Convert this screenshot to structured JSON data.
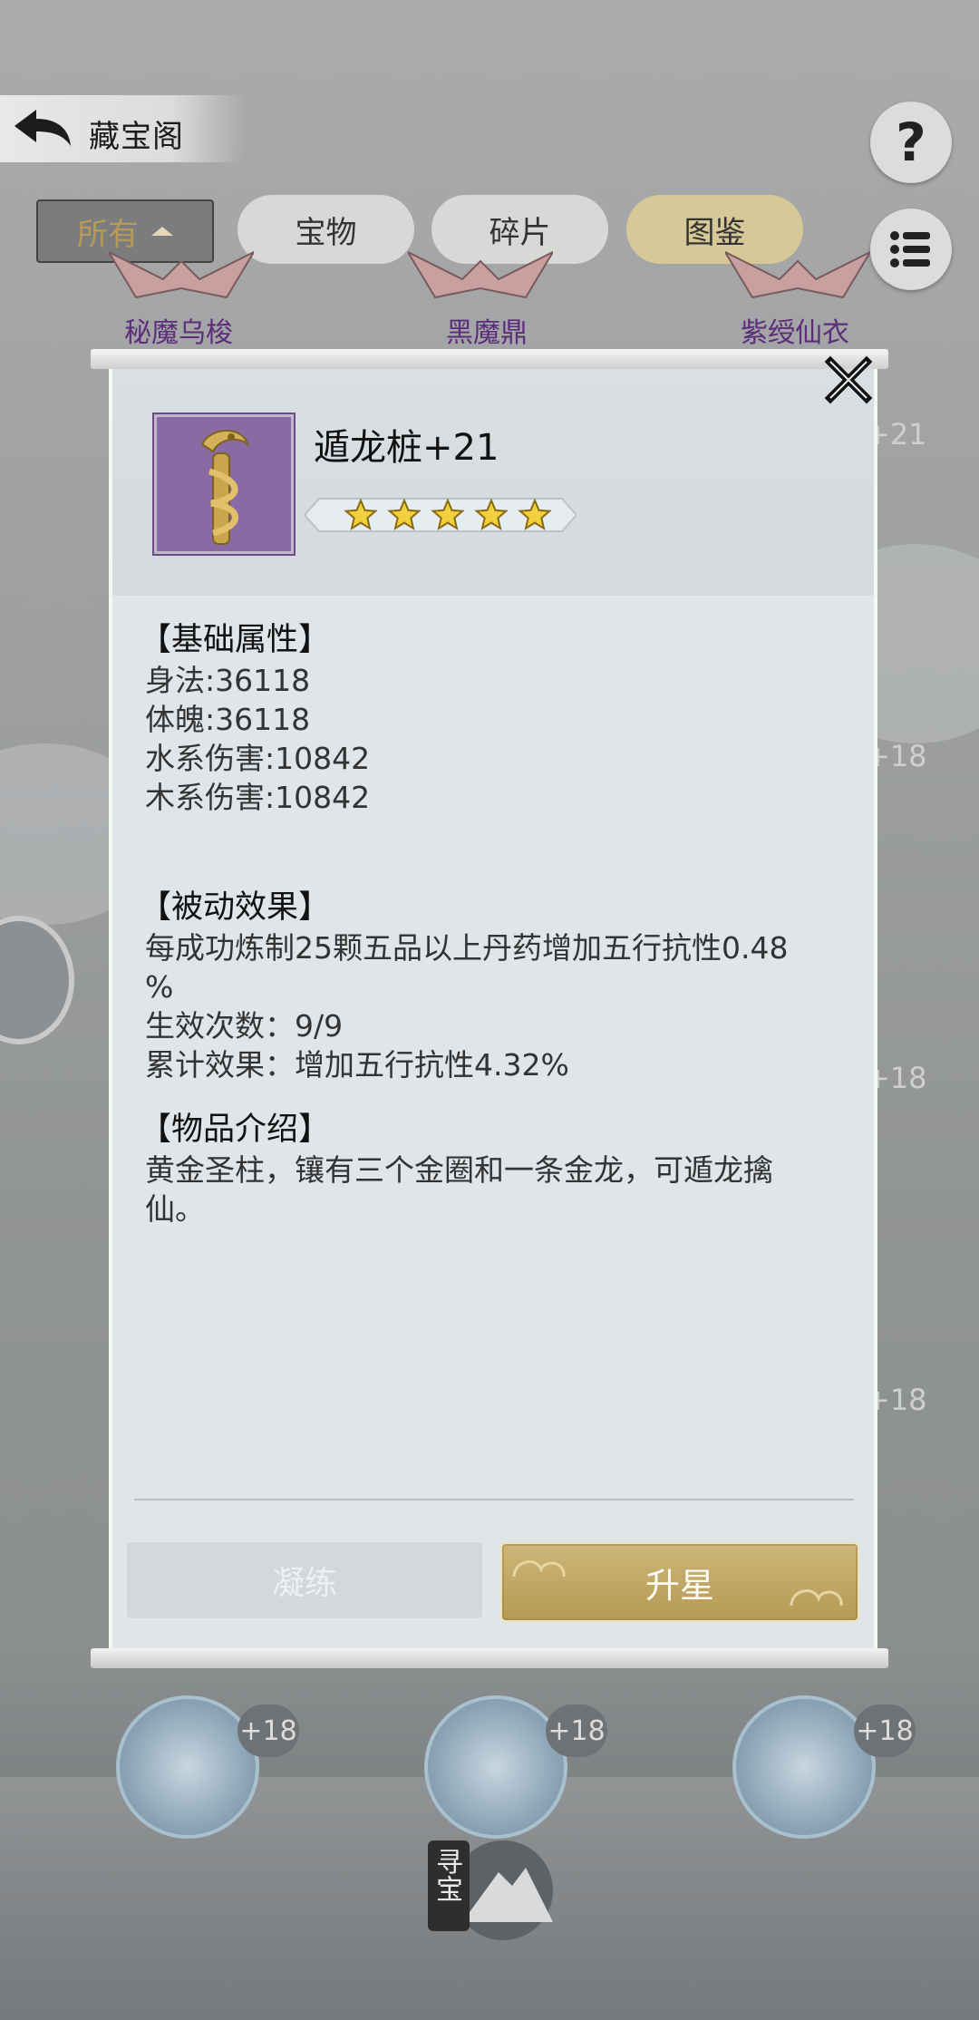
{
  "header": {
    "title": "藏宝阁",
    "help_label": "?"
  },
  "tabs": [
    {
      "label": "所有",
      "active": true
    },
    {
      "label": "宝物"
    },
    {
      "label": "碎片"
    },
    {
      "label": "图鉴"
    }
  ],
  "background_items": {
    "names": [
      "秘魔乌梭",
      "黑魔鼎",
      "紫绶仙衣"
    ],
    "side_levels": [
      "+21",
      "+18",
      "+18",
      "+18"
    ],
    "bottom_levels": [
      "+18",
      "+18",
      "+18"
    ],
    "seek_label": "寻宝"
  },
  "modal": {
    "item_title": "遁龙桩+21",
    "stars": 5,
    "base_attr_heading": "【基础属性】",
    "base_attrs": [
      "身法:36118",
      "体魄:36118",
      "水系伤害:10842",
      "木系伤害:10842"
    ],
    "passive_heading": "【被动效果】",
    "passive_line1": "每成功炼制25颗五品以上丹药增加五行抗性0.48",
    "passive_line2": "%",
    "passive_count": "生效次数：9/9",
    "passive_total": "累计效果：增加五行抗性4.32%",
    "intro_heading": "【物品介绍】",
    "intro_line1": "黄金圣柱，镶有三个金圈和一条金龙，可遁龙擒",
    "intro_line2": "仙。",
    "refine_label": "凝练",
    "upstar_label": "升星"
  },
  "colors": {
    "accent_gold": "#b69a54",
    "icon_purple": "#8a6aa3",
    "item_name_purple": "#5c2d7a"
  }
}
